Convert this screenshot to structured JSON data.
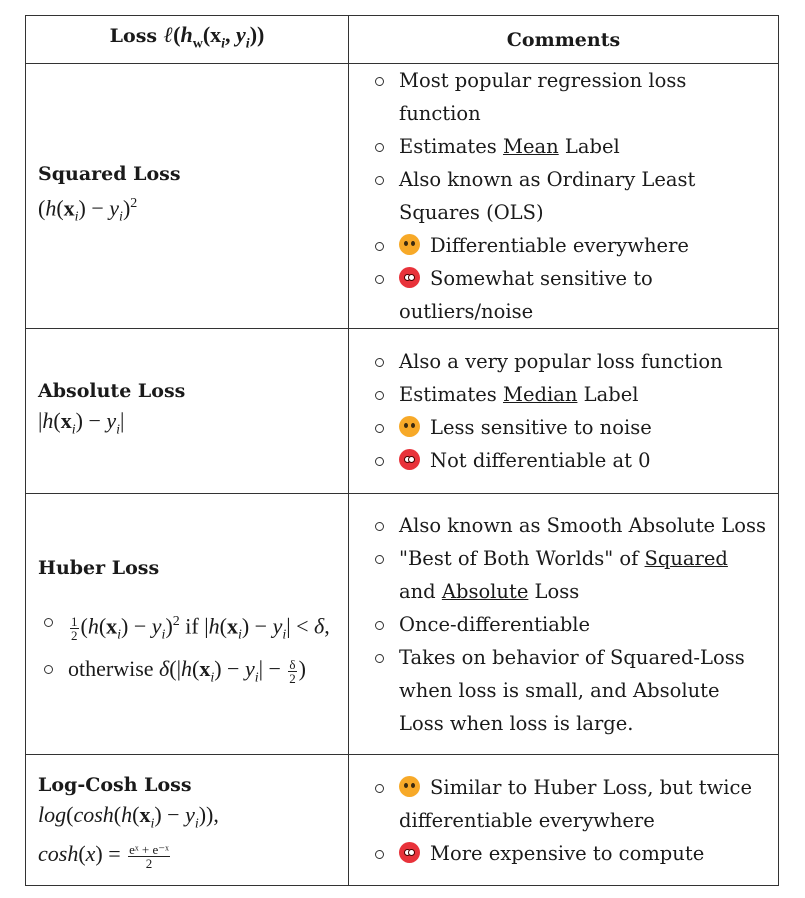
{
  "header": {
    "loss_label": "Loss ",
    "loss_formula": [
      [
        "ℓ",
        "i"
      ],
      [
        "(",
        ""
      ],
      [
        "h",
        "i"
      ],
      [
        "w",
        "subb"
      ],
      [
        "(",
        ""
      ],
      [
        "x",
        "b"
      ],
      [
        "i",
        "sub"
      ],
      [
        ", ",
        ""
      ],
      [
        "y",
        "i"
      ],
      [
        "i",
        "sub"
      ],
      [
        "))",
        ""
      ]
    ],
    "comments_label": "Comments"
  },
  "rows": [
    {
      "name": "Squared Loss",
      "formula": [
        [
          "(",
          ""
        ],
        [
          "h",
          "i"
        ],
        [
          "(",
          ""
        ],
        [
          "x",
          "b"
        ],
        [
          "i",
          "sub"
        ],
        [
          ") − ",
          ""
        ],
        [
          "y",
          "i"
        ],
        [
          "i",
          "sub"
        ],
        [
          ")",
          ""
        ],
        [
          "2",
          "sup"
        ]
      ],
      "comments": [
        {
          "parts": [
            [
              "Most popular regression loss function",
              ""
            ]
          ]
        },
        {
          "parts": [
            [
              "Estimates ",
              ""
            ],
            [
              "Mean",
              "u"
            ],
            [
              " Label",
              ""
            ]
          ]
        },
        {
          "parts": [
            [
              "Also known as Ordinary Least Squares (OLS)",
              ""
            ]
          ]
        },
        {
          "emoji": "happy",
          "parts": [
            [
              "Differentiable everywhere",
              ""
            ]
          ]
        },
        {
          "emoji": "angry",
          "parts": [
            [
              "Somewhat sensitive to outliers/noise",
              ""
            ]
          ]
        }
      ]
    },
    {
      "name": "Absolute Loss",
      "formula": [
        [
          "|",
          ""
        ],
        [
          "h",
          "i"
        ],
        [
          "(",
          ""
        ],
        [
          "x",
          "b"
        ],
        [
          "i",
          "sub"
        ],
        [
          ") − ",
          ""
        ],
        [
          "y",
          "i"
        ],
        [
          "i",
          "sub"
        ],
        [
          "|",
          ""
        ]
      ],
      "comments": [
        {
          "parts": [
            [
              "Also a very popular loss function",
              ""
            ]
          ]
        },
        {
          "parts": [
            [
              "Estimates ",
              ""
            ],
            [
              "Median",
              "u"
            ],
            [
              " Label",
              ""
            ]
          ]
        },
        {
          "emoji": "happy",
          "parts": [
            [
              "Less sensitive to noise",
              ""
            ]
          ]
        },
        {
          "emoji": "angry",
          "parts": [
            [
              "Not differentiable at 0",
              ""
            ]
          ]
        }
      ]
    },
    {
      "name": "Huber Loss",
      "cases": [
        [
          [
            "1|2",
            "frac"
          ],
          [
            "(",
            ""
          ],
          [
            "h",
            "i"
          ],
          [
            "(",
            ""
          ],
          [
            "x",
            "b"
          ],
          [
            "i",
            "sub"
          ],
          [
            ") − ",
            ""
          ],
          [
            "y",
            "i"
          ],
          [
            "i",
            "sub"
          ],
          [
            ")",
            ""
          ],
          [
            "2",
            "sup"
          ],
          [
            " if |",
            ""
          ],
          [
            "h",
            "i"
          ],
          [
            "(",
            ""
          ],
          [
            "x",
            "b"
          ],
          [
            "i",
            "sub"
          ],
          [
            ") − ",
            ""
          ],
          [
            "y",
            "i"
          ],
          [
            "i",
            "sub"
          ],
          [
            "| < ",
            ""
          ],
          [
            "δ",
            "i"
          ],
          [
            ",",
            ""
          ]
        ],
        [
          [
            "otherwise ",
            ""
          ],
          [
            "δ",
            "i"
          ],
          [
            "(|",
            ""
          ],
          [
            "h",
            "i"
          ],
          [
            "(",
            ""
          ],
          [
            "x",
            "b"
          ],
          [
            "i",
            "sub"
          ],
          [
            ") − ",
            ""
          ],
          [
            "y",
            "i"
          ],
          [
            "i",
            "sub"
          ],
          [
            "| − ",
            ""
          ],
          [
            "δ|2",
            "frac"
          ],
          [
            ")",
            ""
          ]
        ]
      ],
      "comments": [
        {
          "parts": [
            [
              "Also known as Smooth Absolute Loss",
              ""
            ]
          ]
        },
        {
          "parts": [
            [
              "\"Best of Both Worlds\" of ",
              ""
            ],
            [
              "Squared",
              "u"
            ],
            [
              " and ",
              ""
            ],
            [
              "Absolute",
              "u"
            ],
            [
              " Loss",
              ""
            ]
          ]
        },
        {
          "parts": [
            [
              "Once-differentiable",
              ""
            ]
          ]
        },
        {
          "parts": [
            [
              "Takes on behavior of Squared-Loss when loss is small, and Absolute Loss when loss is large.",
              ""
            ]
          ]
        }
      ]
    },
    {
      "name": "Log-Cosh Loss",
      "formula": [
        [
          "log",
          "i"
        ],
        [
          "(",
          ""
        ],
        [
          "cosh",
          "i"
        ],
        [
          "(",
          ""
        ],
        [
          "h",
          "i"
        ],
        [
          "(",
          ""
        ],
        [
          "x",
          "b"
        ],
        [
          "i",
          "sub"
        ],
        [
          ") − ",
          ""
        ],
        [
          "y",
          "i"
        ],
        [
          "i",
          "sub"
        ],
        [
          ")),",
          ""
        ]
      ],
      "formula2": [
        [
          "cosh",
          "i"
        ],
        [
          "(",
          ""
        ],
        [
          "x",
          "i"
        ],
        [
          ") = ",
          ""
        ],
        [
          "eˣ + e⁻ˣ|2",
          "frac"
        ]
      ],
      "comments": [
        {
          "emoji": "happy",
          "parts": [
            [
              "Similar to Huber Loss, but twice differentiable everywhere",
              ""
            ]
          ]
        },
        {
          "emoji": "angry",
          "parts": [
            [
              "More expensive to compute",
              ""
            ]
          ]
        }
      ]
    }
  ]
}
